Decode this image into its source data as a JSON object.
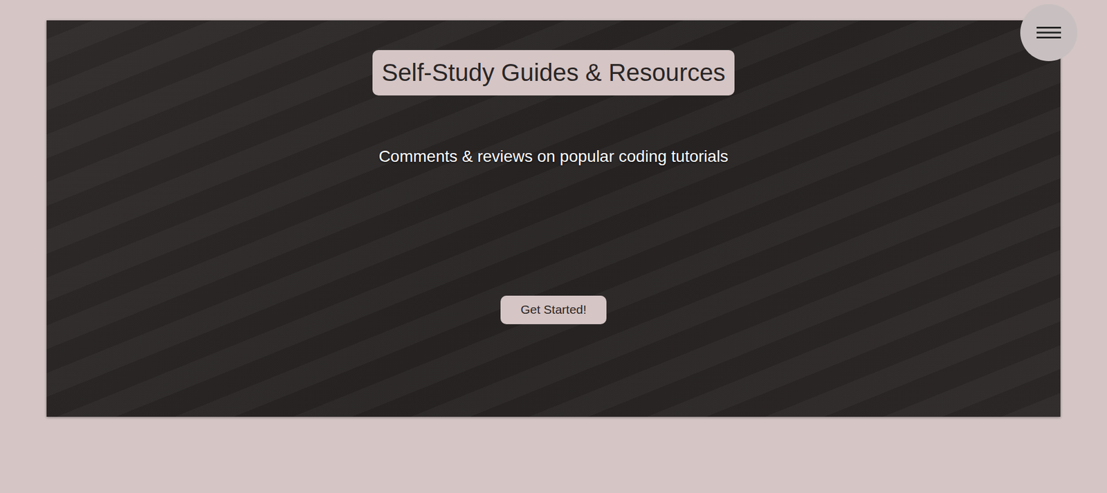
{
  "hero": {
    "title": "Self-Study Guides & Resources",
    "subtitle": "Comments & reviews on popular coding tutorials",
    "button": "Get Started!"
  }
}
